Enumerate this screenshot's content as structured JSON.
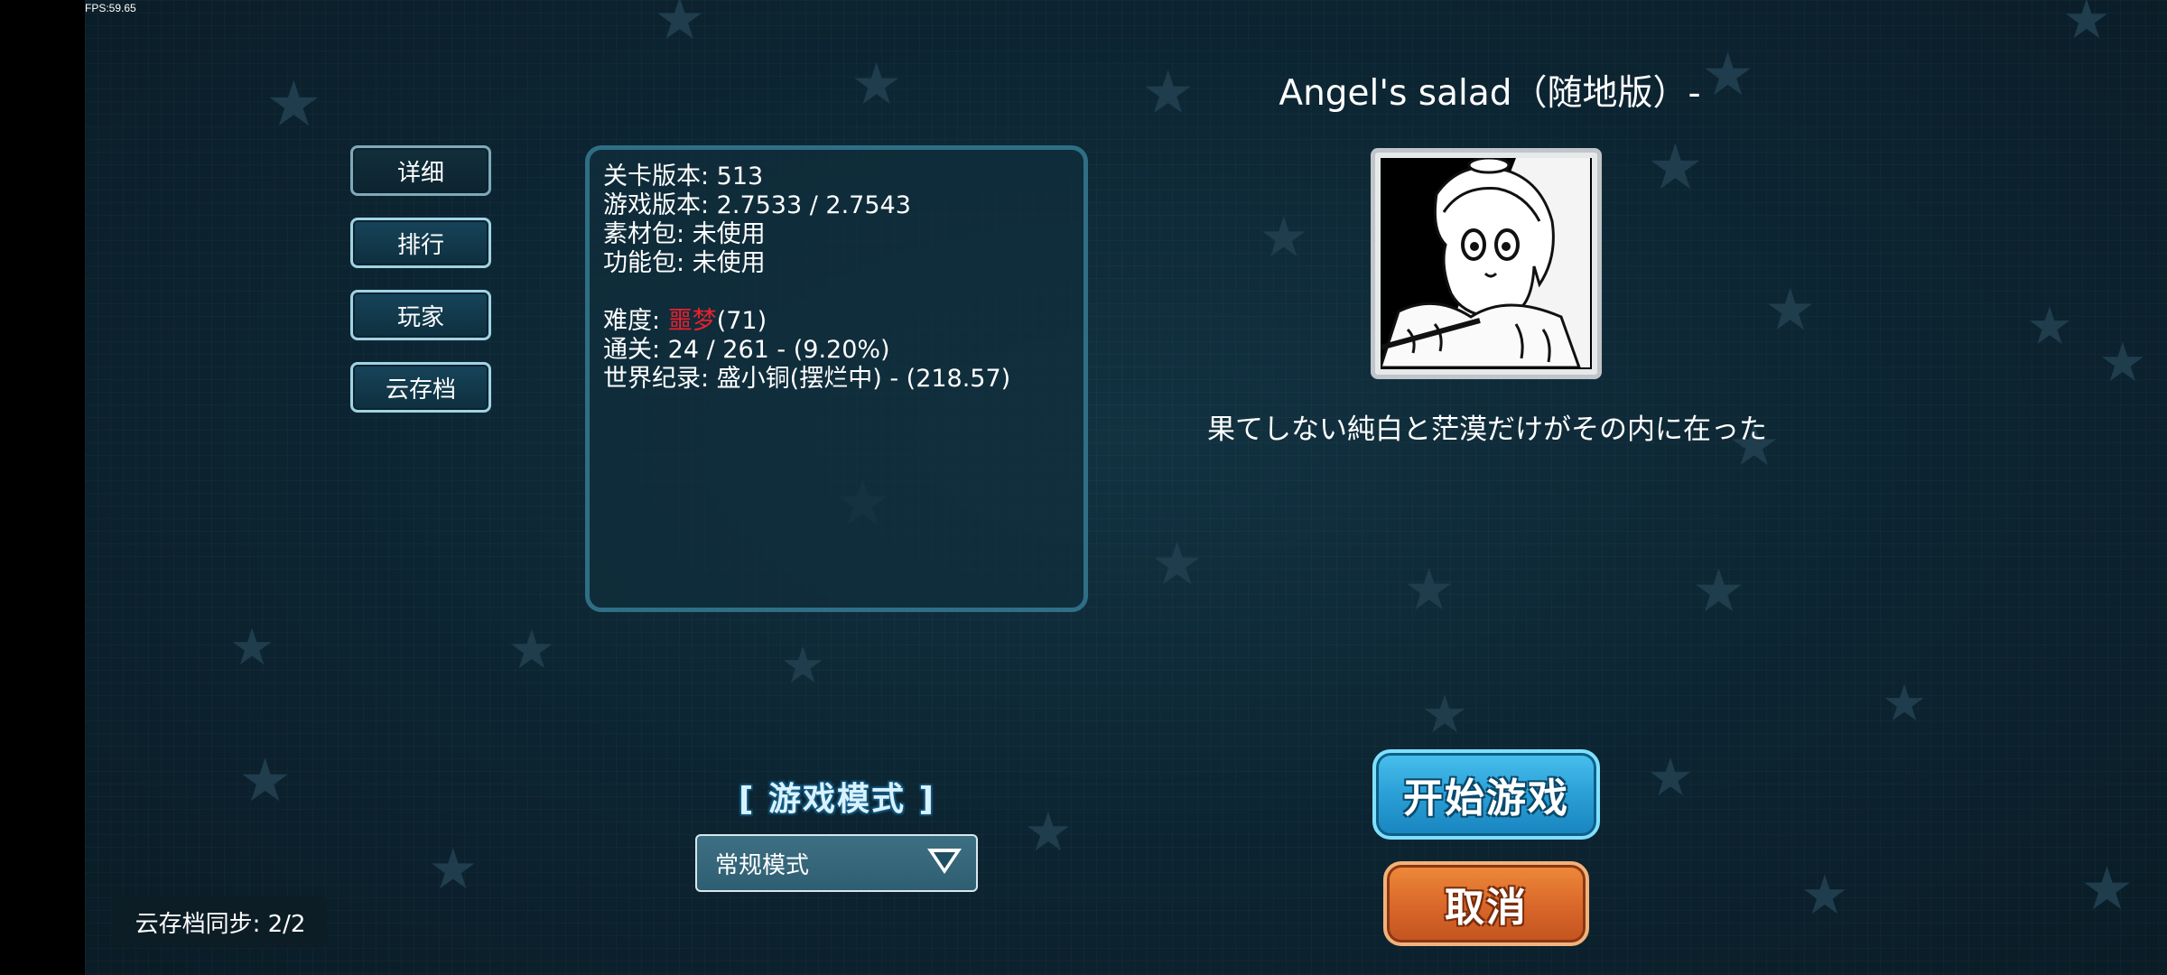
{
  "fps_text": "FPS:59.65",
  "side_menu": {
    "detail": "详细",
    "rank": "排行",
    "players": "玩家",
    "cloud_save": "云存档"
  },
  "info": {
    "level_version": "关卡版本: 513",
    "game_version": "游戏版本: 2.7533 / 2.7543",
    "asset_pack": "素材包: 未使用",
    "feature_pack": "功能包: 未使用",
    "difficulty_label": "难度: ",
    "difficulty_value": "噩梦",
    "difficulty_level": "(71)",
    "clears": "通关: 24 / 261 - (9.20%)",
    "world_record": "世界纪录: 盛小铜(摆烂中) - (218.57)"
  },
  "song": {
    "title": "Angel's salad（随地版）-",
    "description": "果てしない純白と茫漠だけがその内に在った"
  },
  "mode": {
    "title": "[ 游戏模式 ]",
    "selected": "常规模式"
  },
  "actions": {
    "start": "开始游戏",
    "cancel": "取消"
  },
  "cloud_sync": "云存档同步: 2/2",
  "colors": {
    "difficulty": "#e8212e",
    "start_button": "#2a9fd6",
    "cancel_button": "#d9662a",
    "panel_border": "#2f6f86"
  }
}
